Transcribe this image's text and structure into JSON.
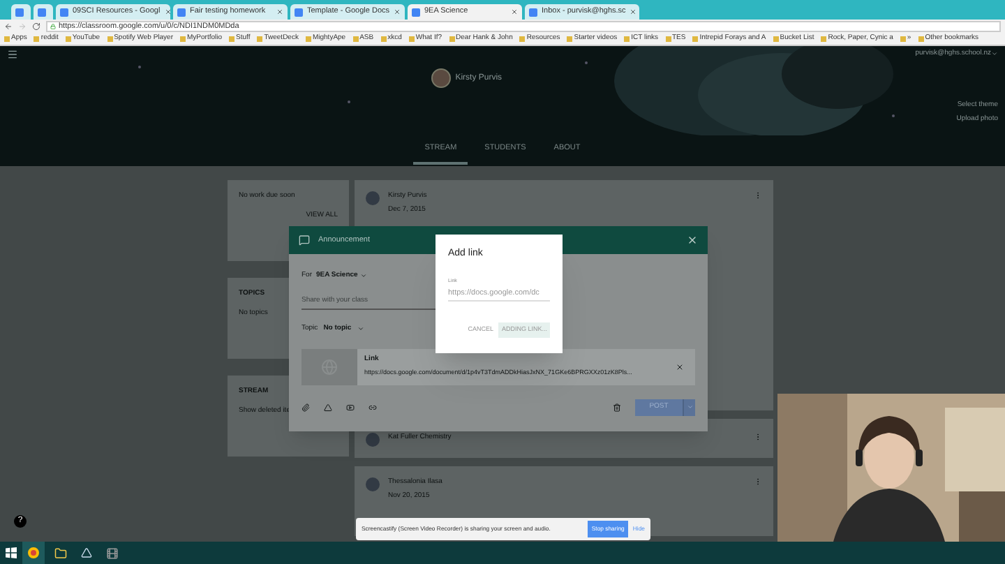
{
  "browser": {
    "tabs": [
      {
        "selected": false
      },
      {
        "selected": false
      },
      {
        "title": "09SCI Resources - Googl",
        "selected": false
      },
      {
        "title": "Fair testing homework",
        "selected": false
      },
      {
        "title": "Template - Google Docs",
        "selected": false
      },
      {
        "title": "9EA Science",
        "selected": true
      },
      {
        "title": "Inbox - purvisk@hghs.sc",
        "selected": false
      }
    ],
    "address": "https://classroom.google.com/u/0/c/NDI1NDM0MDda",
    "bookmarks": [
      "Apps",
      "reddit",
      "YouTube",
      "Spotify Web Player",
      "MyPortfolio",
      "Stuff",
      "TweetDeck",
      "MightyApe",
      "ASB",
      "xkcd",
      "What If?",
      "Dear Hank & John",
      "Resources",
      "Starter videos",
      "ICT links",
      "TES",
      "Intrepid Forays and A",
      "Bucket List",
      "Rock, Paper, Cynic a",
      "»",
      "Other bookmarks"
    ]
  },
  "header": {
    "teacher": "Kirsty Purvis",
    "account": "purvisk@hghs.school.nz",
    "links": [
      "Select theme",
      "Upload photo"
    ]
  },
  "nav": [
    {
      "label": "STREAM",
      "selected": true
    },
    {
      "label": "STUDENTS",
      "selected": false
    },
    {
      "label": "ABOUT",
      "selected": false
    }
  ],
  "sidebar": [
    {
      "text": "No work due soon",
      "action": "VIEW ALL"
    },
    {
      "title": "TOPICS",
      "text": "No topics"
    },
    {
      "title": "STREAM",
      "text": "Show deleted ite"
    }
  ],
  "posts": [
    {
      "author": "Kirsty Purvis",
      "date": "Dec 7, 2015"
    },
    {
      "author": "Kat Fuller Chemistry"
    },
    {
      "author": "Thessalonia Ilasa",
      "date": "Nov 20, 2015"
    }
  ],
  "announcement": {
    "title": "Announcement",
    "for_label": "For",
    "class": "9EA Science",
    "placeholder": "Share with your class",
    "topic_label": "Topic",
    "topic": "No topic",
    "attachment": {
      "title": "Link",
      "url": "https://docs.google.com/document/d/1p4vT3TdmADDkHiasJxNX_71GKe6BPRGXXz01zK8Pls..."
    },
    "post": "POST"
  },
  "add_link": {
    "title": "Add link",
    "label": "Link",
    "value": "https://docs.google.com/dc",
    "cancel": "CANCEL",
    "confirm": "ADDING LINK..."
  },
  "help": "?",
  "share_bar": {
    "text": "Screencastify (Screen Video Recorder) is sharing your screen and audio.",
    "stop": "Stop sharing",
    "hide": "Hide"
  }
}
